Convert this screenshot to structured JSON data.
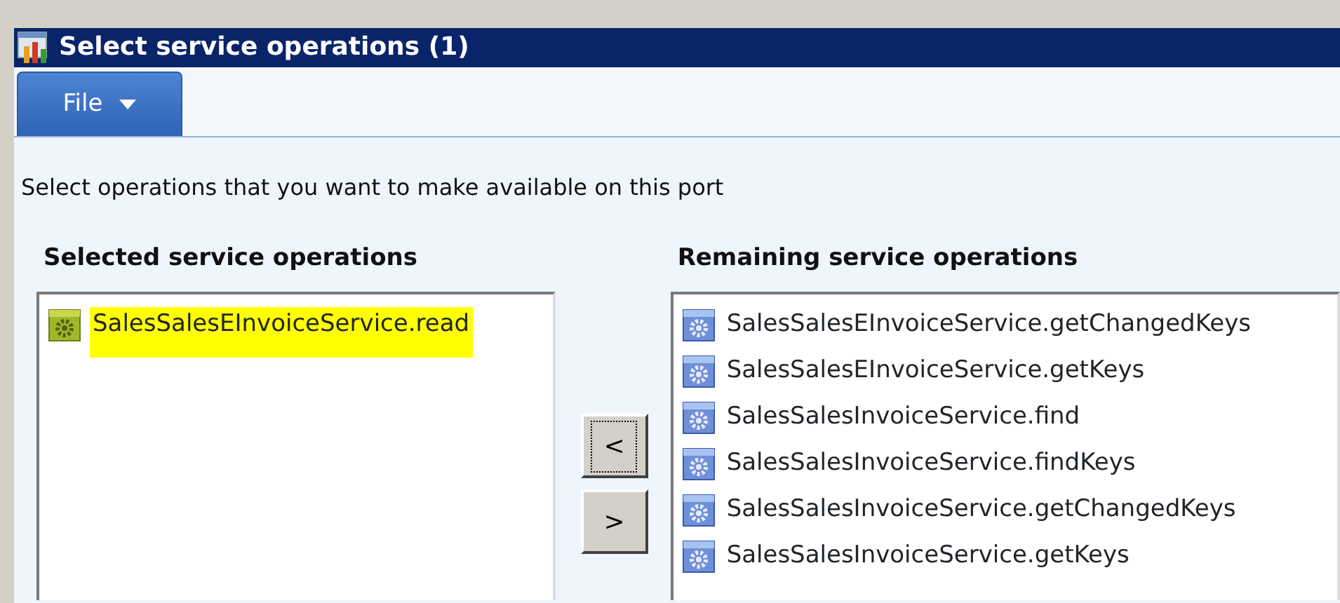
{
  "window": {
    "title": "Select service operations (1)"
  },
  "menu": [
    {
      "label": "File",
      "selected": true
    }
  ],
  "instruction": "Select operations that you want to make available on this port",
  "selected_operations": {
    "heading": "Selected service operations",
    "items": [
      {
        "label": "SalesSalesEInvoiceService.read",
        "highlighted": true
      }
    ]
  },
  "move_buttons": [
    {
      "label": "<",
      "focused": true
    },
    {
      "label": ">",
      "focused": false
    }
  ],
  "remaining_operations": {
    "heading": "Remaining service operations",
    "items": [
      {
        "label": "SalesSalesEInvoiceService.getChangedKeys",
        "highlighted": false
      },
      {
        "label": "SalesSalesEInvoiceService.getKeys",
        "highlighted": false
      },
      {
        "label": "SalesSalesInvoiceService.find",
        "highlighted": false
      },
      {
        "label": "SalesSalesInvoiceService.findKeys",
        "highlighted": false
      },
      {
        "label": "SalesSalesInvoiceService.getChangedKeys",
        "highlighted": false
      },
      {
        "label": "SalesSalesInvoiceService.getKeys",
        "highlighted": false
      }
    ]
  }
}
